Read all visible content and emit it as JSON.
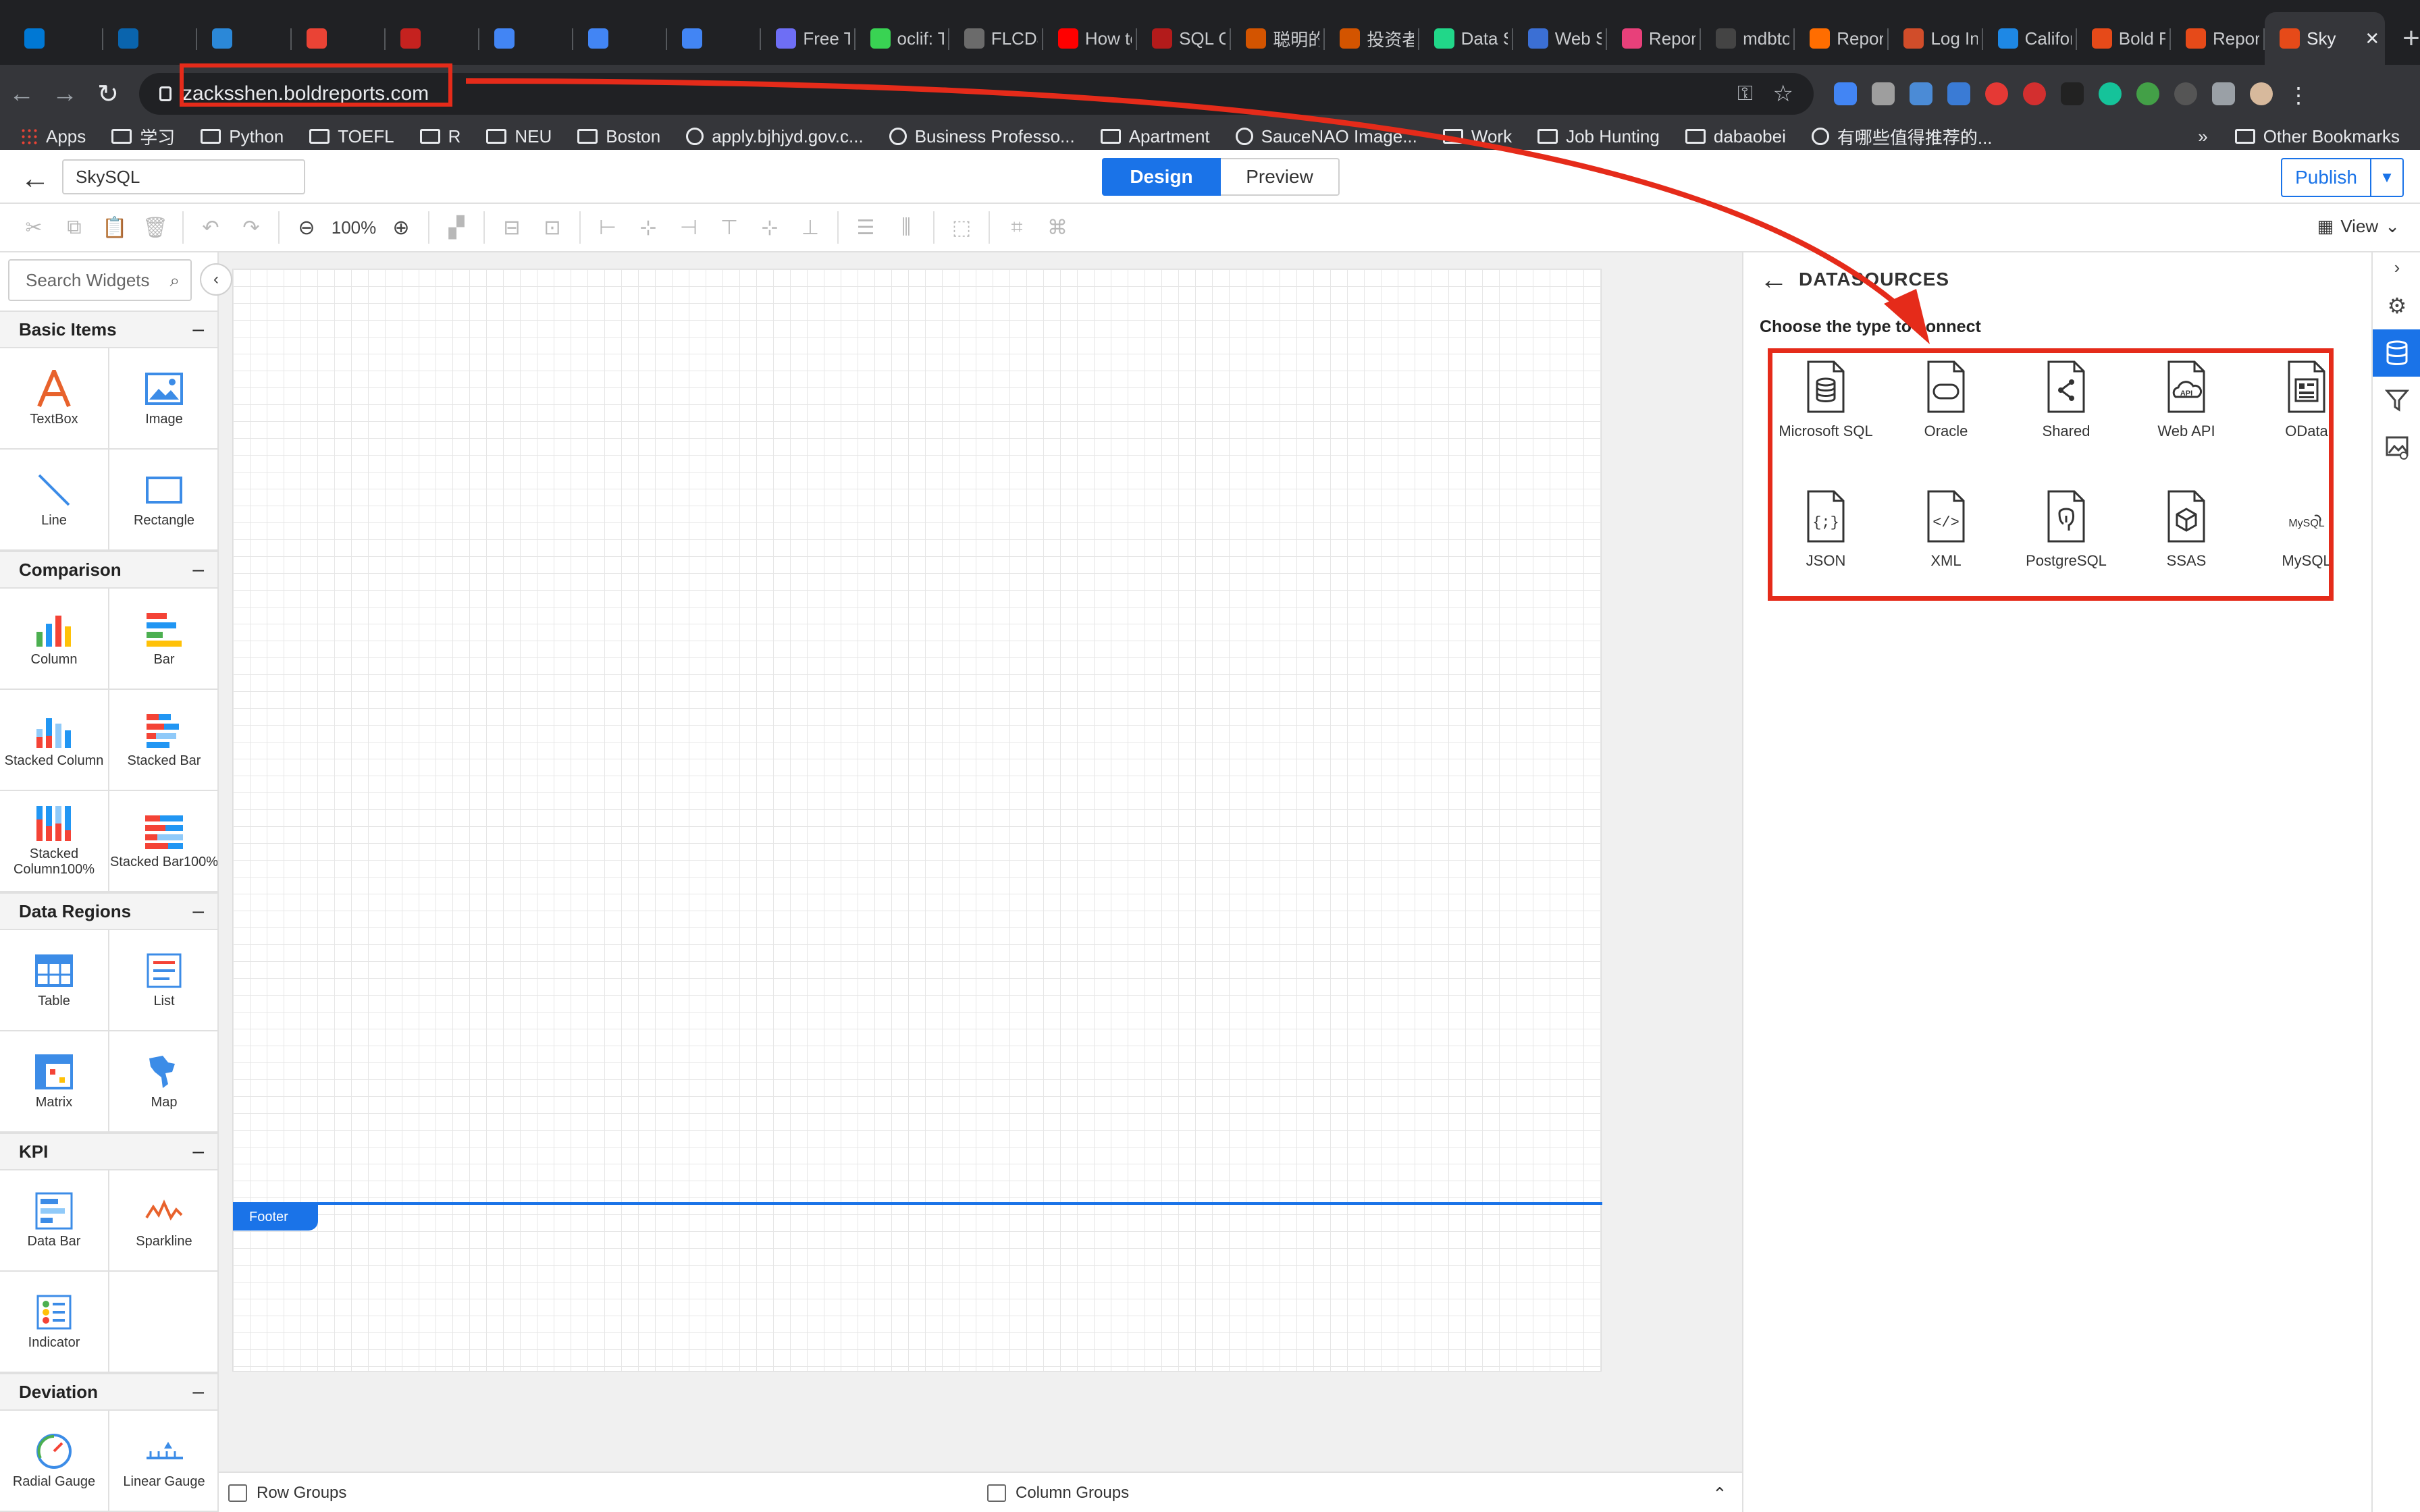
{
  "browser": {
    "tabs": [
      {
        "title": "",
        "color": "#0078d4"
      },
      {
        "title": "",
        "color": "#0a64ad"
      },
      {
        "title": "",
        "color": "#2b88d8"
      },
      {
        "title": "",
        "color": "#ea4335"
      },
      {
        "title": "",
        "color": "#c5221f"
      },
      {
        "title": "",
        "color": "#4285f4"
      },
      {
        "title": "",
        "color": "#4285f4"
      },
      {
        "title": "",
        "color": "#4285f4"
      },
      {
        "title": "Free Tri",
        "color": "#6e6ef5"
      },
      {
        "title": "oclif: Tl",
        "color": "#39d353"
      },
      {
        "title": "FLCDat",
        "color": "#6b6b6b"
      },
      {
        "title": "How to",
        "color": "#ff0000"
      },
      {
        "title": "SQL Co",
        "color": "#b31b1b"
      },
      {
        "title": "聪明的投",
        "color": "#d35400"
      },
      {
        "title": "投资者与",
        "color": "#d35400"
      },
      {
        "title": "Data Sc",
        "color": "#21d789"
      },
      {
        "title": "Web SS",
        "color": "#3b6fd4"
      },
      {
        "title": "Report",
        "color": "#e8407a"
      },
      {
        "title": "mdbtoo",
        "color": "#444444"
      },
      {
        "title": "Report",
        "color": "#ff6d00"
      },
      {
        "title": "Log In c",
        "color": "#d14d2a"
      },
      {
        "title": "Californ",
        "color": "#1e88e5"
      },
      {
        "title": "Bold Re",
        "color": "#e64a19"
      },
      {
        "title": "Reports",
        "color": "#e64a19"
      }
    ],
    "active_tab": "Sky",
    "active_tab_color": "#e64a19",
    "url": "zacksshen.boldreports.com",
    "bookmarks": [
      {
        "label": "Apps",
        "type": "apps"
      },
      {
        "label": "学习",
        "type": "folder"
      },
      {
        "label": "Python",
        "type": "folder"
      },
      {
        "label": "TOEFL",
        "type": "folder"
      },
      {
        "label": "R",
        "type": "folder"
      },
      {
        "label": "NEU",
        "type": "folder"
      },
      {
        "label": "Boston",
        "type": "folder"
      },
      {
        "label": "apply.bjhjyd.gov.c...",
        "type": "site"
      },
      {
        "label": "Business Professo...",
        "type": "site"
      },
      {
        "label": "Apartment",
        "type": "folder"
      },
      {
        "label": "SauceNAO Image...",
        "type": "site"
      },
      {
        "label": "Work",
        "type": "folder"
      },
      {
        "label": "Job Hunting",
        "type": "folder"
      },
      {
        "label": "dabaobei",
        "type": "folder"
      },
      {
        "label": "有哪些值得推荐的...",
        "type": "site"
      }
    ],
    "bookmarks_more": "»",
    "other_bookmarks": "Other Bookmarks"
  },
  "app": {
    "report_name": "SkySQL",
    "design_label": "Design",
    "preview_label": "Preview",
    "publish_label": "Publish",
    "zoom": "100%",
    "view_label": "View",
    "search_placeholder": "Search Widgets",
    "footer_label": "Footer",
    "row_groups": "Row Groups",
    "column_groups": "Column Groups"
  },
  "widgets": {
    "basic": {
      "title": "Basic Items",
      "items": [
        "TextBox",
        "Image",
        "Line",
        "Rectangle"
      ]
    },
    "comparison": {
      "title": "Comparison",
      "items": [
        "Column",
        "Bar",
        "Stacked Column",
        "Stacked Bar",
        "Stacked Column100%",
        "Stacked Bar100%"
      ]
    },
    "data_regions": {
      "title": "Data Regions",
      "items": [
        "Table",
        "List",
        "Matrix",
        "Map"
      ]
    },
    "kpi": {
      "title": "KPI",
      "items": [
        "Data Bar",
        "Sparkline",
        "Indicator"
      ]
    },
    "deviation": {
      "title": "Deviation",
      "items": [
        "Radial Gauge",
        "Linear Gauge"
      ]
    }
  },
  "datasources": {
    "title": "DATASOURCES",
    "subtitle": "Choose the type to connect",
    "items": [
      {
        "label": "Microsoft SQL",
        "icon": "database-icon"
      },
      {
        "label": "Oracle",
        "icon": "oracle-icon"
      },
      {
        "label": "Shared",
        "icon": "share-icon"
      },
      {
        "label": "Web API",
        "icon": "cloud-api-icon"
      },
      {
        "label": "OData",
        "icon": "odata-icon"
      },
      {
        "label": "JSON",
        "icon": "json-icon"
      },
      {
        "label": "XML",
        "icon": "xml-icon"
      },
      {
        "label": "PostgreSQL",
        "icon": "postgresql-icon"
      },
      {
        "label": "SSAS",
        "icon": "cube-icon"
      },
      {
        "label": "MySQL",
        "icon": "mysql-icon"
      }
    ]
  },
  "colors": {
    "accent": "#1a73e8",
    "annotation": "#e52b1a"
  }
}
